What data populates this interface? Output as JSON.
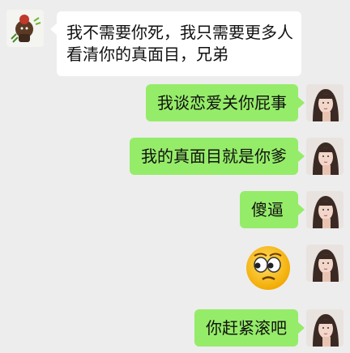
{
  "colors": {
    "background": "#ededed",
    "incoming_bubble": "#ffffff",
    "outgoing_bubble": "#95ec69"
  },
  "messages": [
    {
      "side": "left",
      "avatar": "cartoon-character-avatar",
      "lines": [
        "我不需要你死，我只需要更多人",
        "看清你的真面目，兄弟"
      ]
    },
    {
      "side": "right",
      "avatar": "woman-portrait-avatar",
      "text": "我谈恋爱关你屁事"
    },
    {
      "side": "right",
      "avatar": "woman-portrait-avatar",
      "text": "我的真面目就是你爹"
    },
    {
      "side": "right",
      "avatar": "woman-portrait-avatar",
      "text": "傻逼"
    },
    {
      "side": "right",
      "avatar": "woman-portrait-avatar",
      "emoji": "rolling-eyes-emoji"
    },
    {
      "side": "right",
      "avatar": "woman-portrait-avatar",
      "text": "你赶紧滚吧"
    }
  ]
}
